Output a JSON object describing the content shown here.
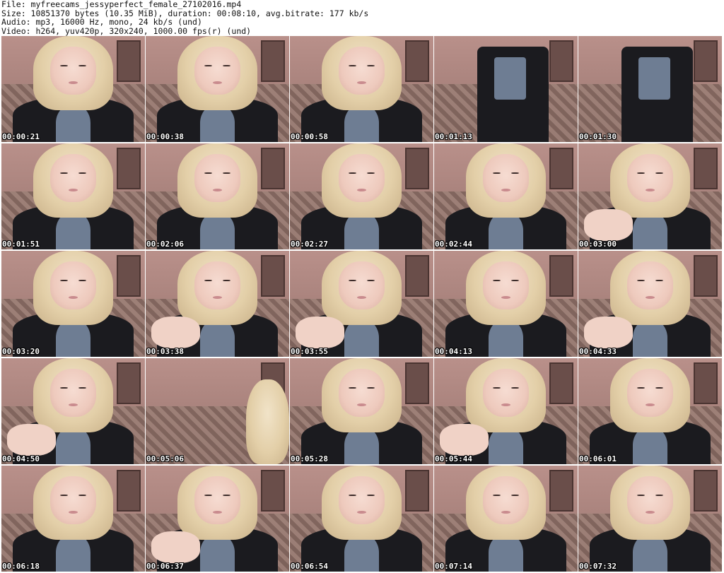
{
  "header": {
    "file": "File: myfreecams_jessyperfect_female_27102016.mp4",
    "size": "Size: 10851370 bytes (10.35 MiB), duration: 00:08:10, avg.bitrate: 177 kb/s",
    "audio": "Audio: mp3, 16000 Hz, mono, 24 kb/s (und)",
    "video": "Video: h264, yuv420p, 320x240, 1000.00 fps(r) (und)"
  },
  "thumbnails": [
    {
      "time": "00:00:21",
      "variant": "face"
    },
    {
      "time": "00:00:38",
      "variant": "face"
    },
    {
      "time": "00:00:58",
      "variant": "face"
    },
    {
      "time": "00:01:13",
      "variant": "body"
    },
    {
      "time": "00:01:30",
      "variant": "body"
    },
    {
      "time": "00:01:51",
      "variant": "face"
    },
    {
      "time": "00:02:06",
      "variant": "face"
    },
    {
      "time": "00:02:27",
      "variant": "face"
    },
    {
      "time": "00:02:44",
      "variant": "face"
    },
    {
      "time": "00:03:00",
      "variant": "hand"
    },
    {
      "time": "00:03:20",
      "variant": "face"
    },
    {
      "time": "00:03:38",
      "variant": "hand"
    },
    {
      "time": "00:03:55",
      "variant": "hand"
    },
    {
      "time": "00:04:13",
      "variant": "face"
    },
    {
      "time": "00:04:33",
      "variant": "hand"
    },
    {
      "time": "00:04:50",
      "variant": "hand"
    },
    {
      "time": "00:05:06",
      "variant": "empty"
    },
    {
      "time": "00:05:28",
      "variant": "face"
    },
    {
      "time": "00:05:44",
      "variant": "hand"
    },
    {
      "time": "00:06:01",
      "variant": "face"
    },
    {
      "time": "00:06:18",
      "variant": "face"
    },
    {
      "time": "00:06:37",
      "variant": "hand"
    },
    {
      "time": "00:06:54",
      "variant": "face"
    },
    {
      "time": "00:07:14",
      "variant": "face"
    },
    {
      "time": "00:07:32",
      "variant": "face"
    }
  ]
}
